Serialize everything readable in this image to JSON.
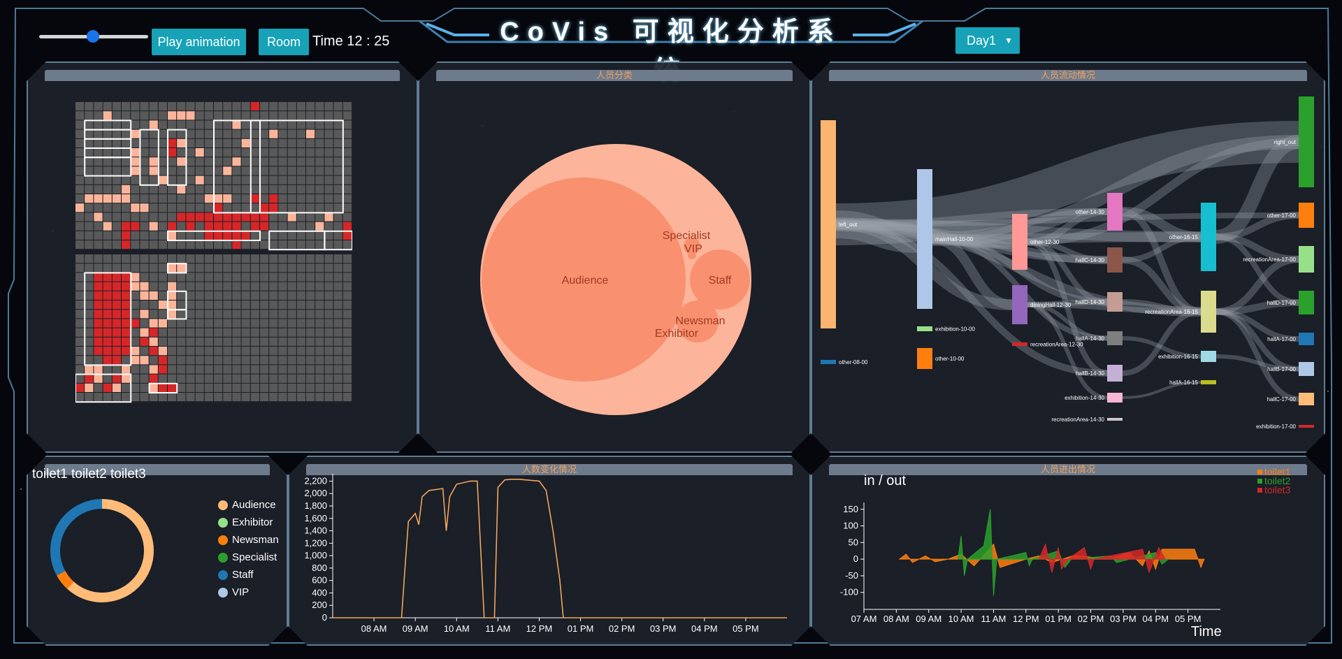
{
  "header": {
    "title": "CoVis 可视化分析系统",
    "play_label": "Play animation",
    "room_label": "Room",
    "time_label": "Time 12 : 25",
    "day_selected": "Day1",
    "slider_value": 0.5
  },
  "panels": {
    "heatmap": {
      "title": ""
    },
    "bubble": {
      "title": "人员分类"
    },
    "sankey": {
      "title": "人员流动情况"
    },
    "donut": {
      "title": ""
    },
    "line": {
      "title": "人数变化情况"
    },
    "inout": {
      "title": "人员进出情况"
    }
  },
  "bubble": {
    "labels": [
      "Audience",
      "Specialist",
      "VIP",
      "Staff",
      "Newsman",
      "Exhibitor"
    ]
  },
  "sankey": {
    "nodes": [
      "left_out",
      "other-08-00",
      "mainHall-10-00",
      "exhibition-10-00",
      "other-10-00",
      "other-12-30",
      "diningHall-12-30",
      "recreationArea-12-30",
      "other-14-30",
      "hallC-14-30",
      "hallD-14-30",
      "hallA-14-30",
      "hallB-14-30",
      "exhibition-14-30",
      "recreationArea-14-30",
      "other-16-15",
      "recreationArea-16-15",
      "exhibition-16-15",
      "hallA-16-15",
      "right_out",
      "other-17-00",
      "recreationArea-17-00",
      "hallD-17-00",
      "hallA-17-00",
      "hallB-17-00",
      "hallC-17-00",
      "exhibition-17-00"
    ]
  },
  "donut": {
    "header": "toilet1 toilet2 toilet3",
    "legend": [
      "Audience",
      "Exhibitor",
      "Newsman",
      "Specialist",
      "Staff",
      "VIP"
    ],
    "colors": {
      "Audience": "#ffbb78",
      "Exhibitor": "#98df8a",
      "Newsman": "#ff7f0e",
      "Specialist": "#2ca02c",
      "Staff": "#1f77b4",
      "VIP": "#aec7e8"
    }
  },
  "chart_data": [
    {
      "type": "line",
      "title": "人数变化情况",
      "xlabel": "",
      "ylabel": "",
      "x_ticks": [
        "08 AM",
        "09 AM",
        "10 AM",
        "11 AM",
        "12 PM",
        "01 PM",
        "02 PM",
        "03 PM",
        "04 PM",
        "05 PM"
      ],
      "y_ticks": [
        "0",
        "200",
        "400",
        "600",
        "800",
        "1,000",
        "1,200",
        "1,400",
        "1,600",
        "1,800",
        "2,000",
        "2,200"
      ],
      "ylim": [
        0,
        2250
      ],
      "xlim_hours": [
        7.0,
        18.0
      ],
      "x": [
        "07:00",
        "08:30",
        "08:40",
        "08:45",
        "08:50",
        "09:00",
        "09:05",
        "09:10",
        "09:20",
        "09:40",
        "09:45",
        "09:50",
        "10:00",
        "10:20",
        "10:30",
        "10:40",
        "10:45",
        "10:55",
        "11:00",
        "11:10",
        "11:20",
        "11:30",
        "12:00",
        "12:10",
        "12:20",
        "12:30",
        "12:35",
        "12:40",
        "18:00"
      ],
      "values": [
        0,
        0,
        0,
        800,
        1550,
        1680,
        1500,
        1950,
        2050,
        2080,
        1400,
        1950,
        2150,
        2200,
        2200,
        0,
        0,
        0,
        2100,
        2220,
        2230,
        2230,
        2200,
        2050,
        1400,
        600,
        0,
        0,
        0
      ],
      "line_color": "#f2a65a"
    },
    {
      "type": "area",
      "title": "人员进出情况",
      "ylabel": "in / out",
      "xlabel": "Time",
      "x_ticks": [
        "07 AM",
        "08 AM",
        "09 AM",
        "10 AM",
        "11 AM",
        "12 PM",
        "01 PM",
        "02 PM",
        "03 PM",
        "04 PM",
        "05 PM"
      ],
      "y_ticks": [
        "150",
        "100",
        "50",
        "0",
        "-50",
        "-100"
      ],
      "ylim": [
        -130,
        160
      ],
      "series": [
        {
          "name": "toilet1",
          "color": "#ff7f0e",
          "points": [
            [
              8.1,
              0
            ],
            [
              8.3,
              15
            ],
            [
              8.5,
              -10
            ],
            [
              8.9,
              10
            ],
            [
              9.2,
              -8
            ],
            [
              9.6,
              0
            ],
            [
              10.0,
              15
            ],
            [
              10.4,
              -20
            ],
            [
              11.0,
              45
            ],
            [
              11.2,
              -25
            ],
            [
              12.0,
              0
            ],
            [
              12.4,
              10
            ],
            [
              12.8,
              -10
            ],
            [
              13.5,
              12
            ],
            [
              14.5,
              0
            ],
            [
              15.2,
              20
            ],
            [
              15.6,
              -20
            ],
            [
              15.8,
              25
            ],
            [
              16.0,
              -30
            ],
            [
              16.2,
              30
            ],
            [
              17.2,
              30
            ],
            [
              17.4,
              -25
            ],
            [
              17.5,
              0
            ]
          ]
        },
        {
          "name": "toilet2",
          "color": "#2ca02c",
          "points": [
            [
              9.9,
              0
            ],
            [
              10.0,
              70
            ],
            [
              10.1,
              -50
            ],
            [
              10.2,
              0
            ],
            [
              10.7,
              40
            ],
            [
              10.9,
              150
            ],
            [
              11.0,
              -110
            ],
            [
              11.1,
              0
            ],
            [
              12.0,
              20
            ],
            [
              12.1,
              -20
            ],
            [
              12.2,
              0
            ],
            [
              13.0,
              25
            ],
            [
              13.2,
              -25
            ],
            [
              13.4,
              0
            ],
            [
              14.6,
              10
            ],
            [
              14.8,
              -10
            ],
            [
              15.2,
              0
            ],
            [
              16.0,
              20
            ],
            [
              16.2,
              -15
            ],
            [
              16.4,
              0
            ]
          ]
        },
        {
          "name": "toilet3",
          "color": "#d62728",
          "points": [
            [
              12.4,
              0
            ],
            [
              12.6,
              45
            ],
            [
              12.8,
              -40
            ],
            [
              13.0,
              35
            ],
            [
              13.1,
              -30
            ],
            [
              13.3,
              0
            ],
            [
              13.8,
              35
            ],
            [
              14.0,
              -30
            ],
            [
              14.1,
              0
            ],
            [
              15.6,
              30
            ],
            [
              15.8,
              -40
            ],
            [
              16.1,
              35
            ],
            [
              16.3,
              0
            ]
          ]
        }
      ]
    }
  ]
}
